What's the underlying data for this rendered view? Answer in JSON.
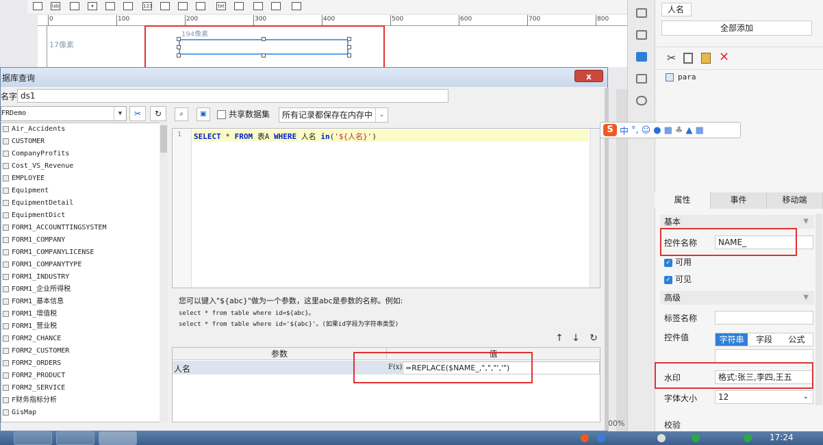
{
  "designer": {
    "ruler_labels": [
      "0",
      "100",
      "200",
      "300",
      "400",
      "500",
      "600",
      "700",
      "800"
    ],
    "width_px_label": "194像素",
    "height_px_label": "17像素",
    "zoom_partial": "00%"
  },
  "right_panel": {
    "field_name": "人名",
    "add_all_label": "全部添加",
    "param_item": "para",
    "tabs": [
      "属性",
      "事件",
      "移动端"
    ],
    "section_basic": "基本",
    "control_name_label": "控件名称",
    "control_name_value": "NAME_",
    "enabled_label": "可用",
    "visible_label": "可见",
    "section_advanced": "高级",
    "tag_name_label": "标签名称",
    "tag_name_value": "",
    "control_value_label": "控件值",
    "control_value_options": [
      "字符串",
      "字段",
      "公式"
    ],
    "watermark_label": "水印",
    "watermark_value": "格式:张三,李四,王五",
    "font_size_label": "字体大小",
    "font_size_value": "12",
    "validation_label": "校验"
  },
  "ime": {
    "logo": "S",
    "mode": "中",
    "punct": "°,"
  },
  "dialog": {
    "title": "据库查询",
    "close_label": "x",
    "name_label": "名字:",
    "name_value": "ds1",
    "database": "FRDemo",
    "tables": [
      "Air_Accidents",
      "CUSTOMER",
      "CompanyProfits",
      "Cost_VS_Revenue",
      "EMPLOYEE",
      "Equipment",
      "EquipmentDetail",
      "EquipmentDict",
      "FORM1_ACCOUNTTINGSYSTEM",
      "FORM1_COMPANY",
      "FORM1_COMPANYLICENSE",
      "FORM1_COMPANYTYPE",
      "FORM1_INDUSTRY",
      "FORM1_企业所得税",
      "FORM1_基本信息",
      "FORM1_增值税",
      "FORM1_营业税",
      "FORM2_CHANCE",
      "FORM2_CUSTOMER",
      "FORM2_ORDERS",
      "FORM2_PRODUCT",
      "FORM2_SERVICE",
      "F财务指标分析",
      "GisMap"
    ],
    "share_label": "共享数据集",
    "memory_option": "所有记录都保存在内存中",
    "sql": {
      "line_no": "1",
      "kw_select": "SELECT",
      "star": " * ",
      "kw_from": "FROM",
      "table": " 表A ",
      "kw_where": "WHERE",
      "column": " 人名 ",
      "kw_in": "in",
      "open": "(",
      "literal": "'${人名}'",
      "close": ")"
    },
    "hint_line1": "您可以键入\"${abc}\"做为一个参数，这里abc是参数的名称。例如:",
    "hint_line2": "select * from table where id=${abc}。",
    "hint_line3": "select * from table where id='${abc}'。(如果id字段为字符串类型)",
    "param_header_name": "参数",
    "param_header_value": "值",
    "param_name": "人名",
    "param_value": "=REPLACE($NAME_,\",\",\"','\")"
  },
  "taskbar": {
    "clock": "17:24"
  }
}
